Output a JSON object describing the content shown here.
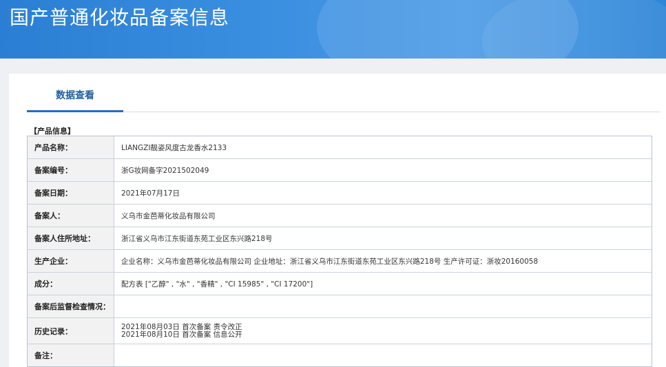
{
  "header": {
    "title": "国产普通化妆品备案信息"
  },
  "tabs": [
    {
      "label": "数据查看",
      "active": true
    }
  ],
  "section": {
    "title": "【产品信息】"
  },
  "fields": {
    "product_name": {
      "label": "产品名称：",
      "value": "LIANGZI靓姿风度古龙香水2133"
    },
    "record_no": {
      "label": "备案编号：",
      "value": "浙G妆网备字2021502049"
    },
    "record_date": {
      "label": "备案日期：",
      "value": "2021年07月17日"
    },
    "registrant": {
      "label": "备案人：",
      "value": "义乌市金芭蒂化妆品有限公司"
    },
    "registrant_address": {
      "label": "备案人住所地址：",
      "value": "浙江省义乌市江东街道东苑工业区东兴路218号"
    },
    "manufacturer": {
      "label": "生产企业：",
      "value": "企业名称：义乌市金芭蒂化妆品有限公司 企业地址：浙江省义乌市江东街道东苑工业区东兴路218号 生产许可证：浙妆20160058"
    },
    "ingredients": {
      "label": "成分：",
      "value": "配方表 [\"乙醇\" , \"水\" , \"香精\" , \"CI 15985\" , \"CI 17200\"]"
    },
    "post_inspection": {
      "label": "备案后监督检查情况：",
      "value": ""
    },
    "history": {
      "label": "历史记录：",
      "lines": [
        "2021年08月03日 首次备案 责令改正",
        "2021年08月10日 首次备案 信息公开"
      ]
    },
    "remarks": {
      "label": "备注：",
      "value": ""
    }
  },
  "colors": {
    "header_blue": "#2f86d8",
    "tab_accent": "#1f6fbf",
    "label_bg": "#f2f2f2"
  }
}
